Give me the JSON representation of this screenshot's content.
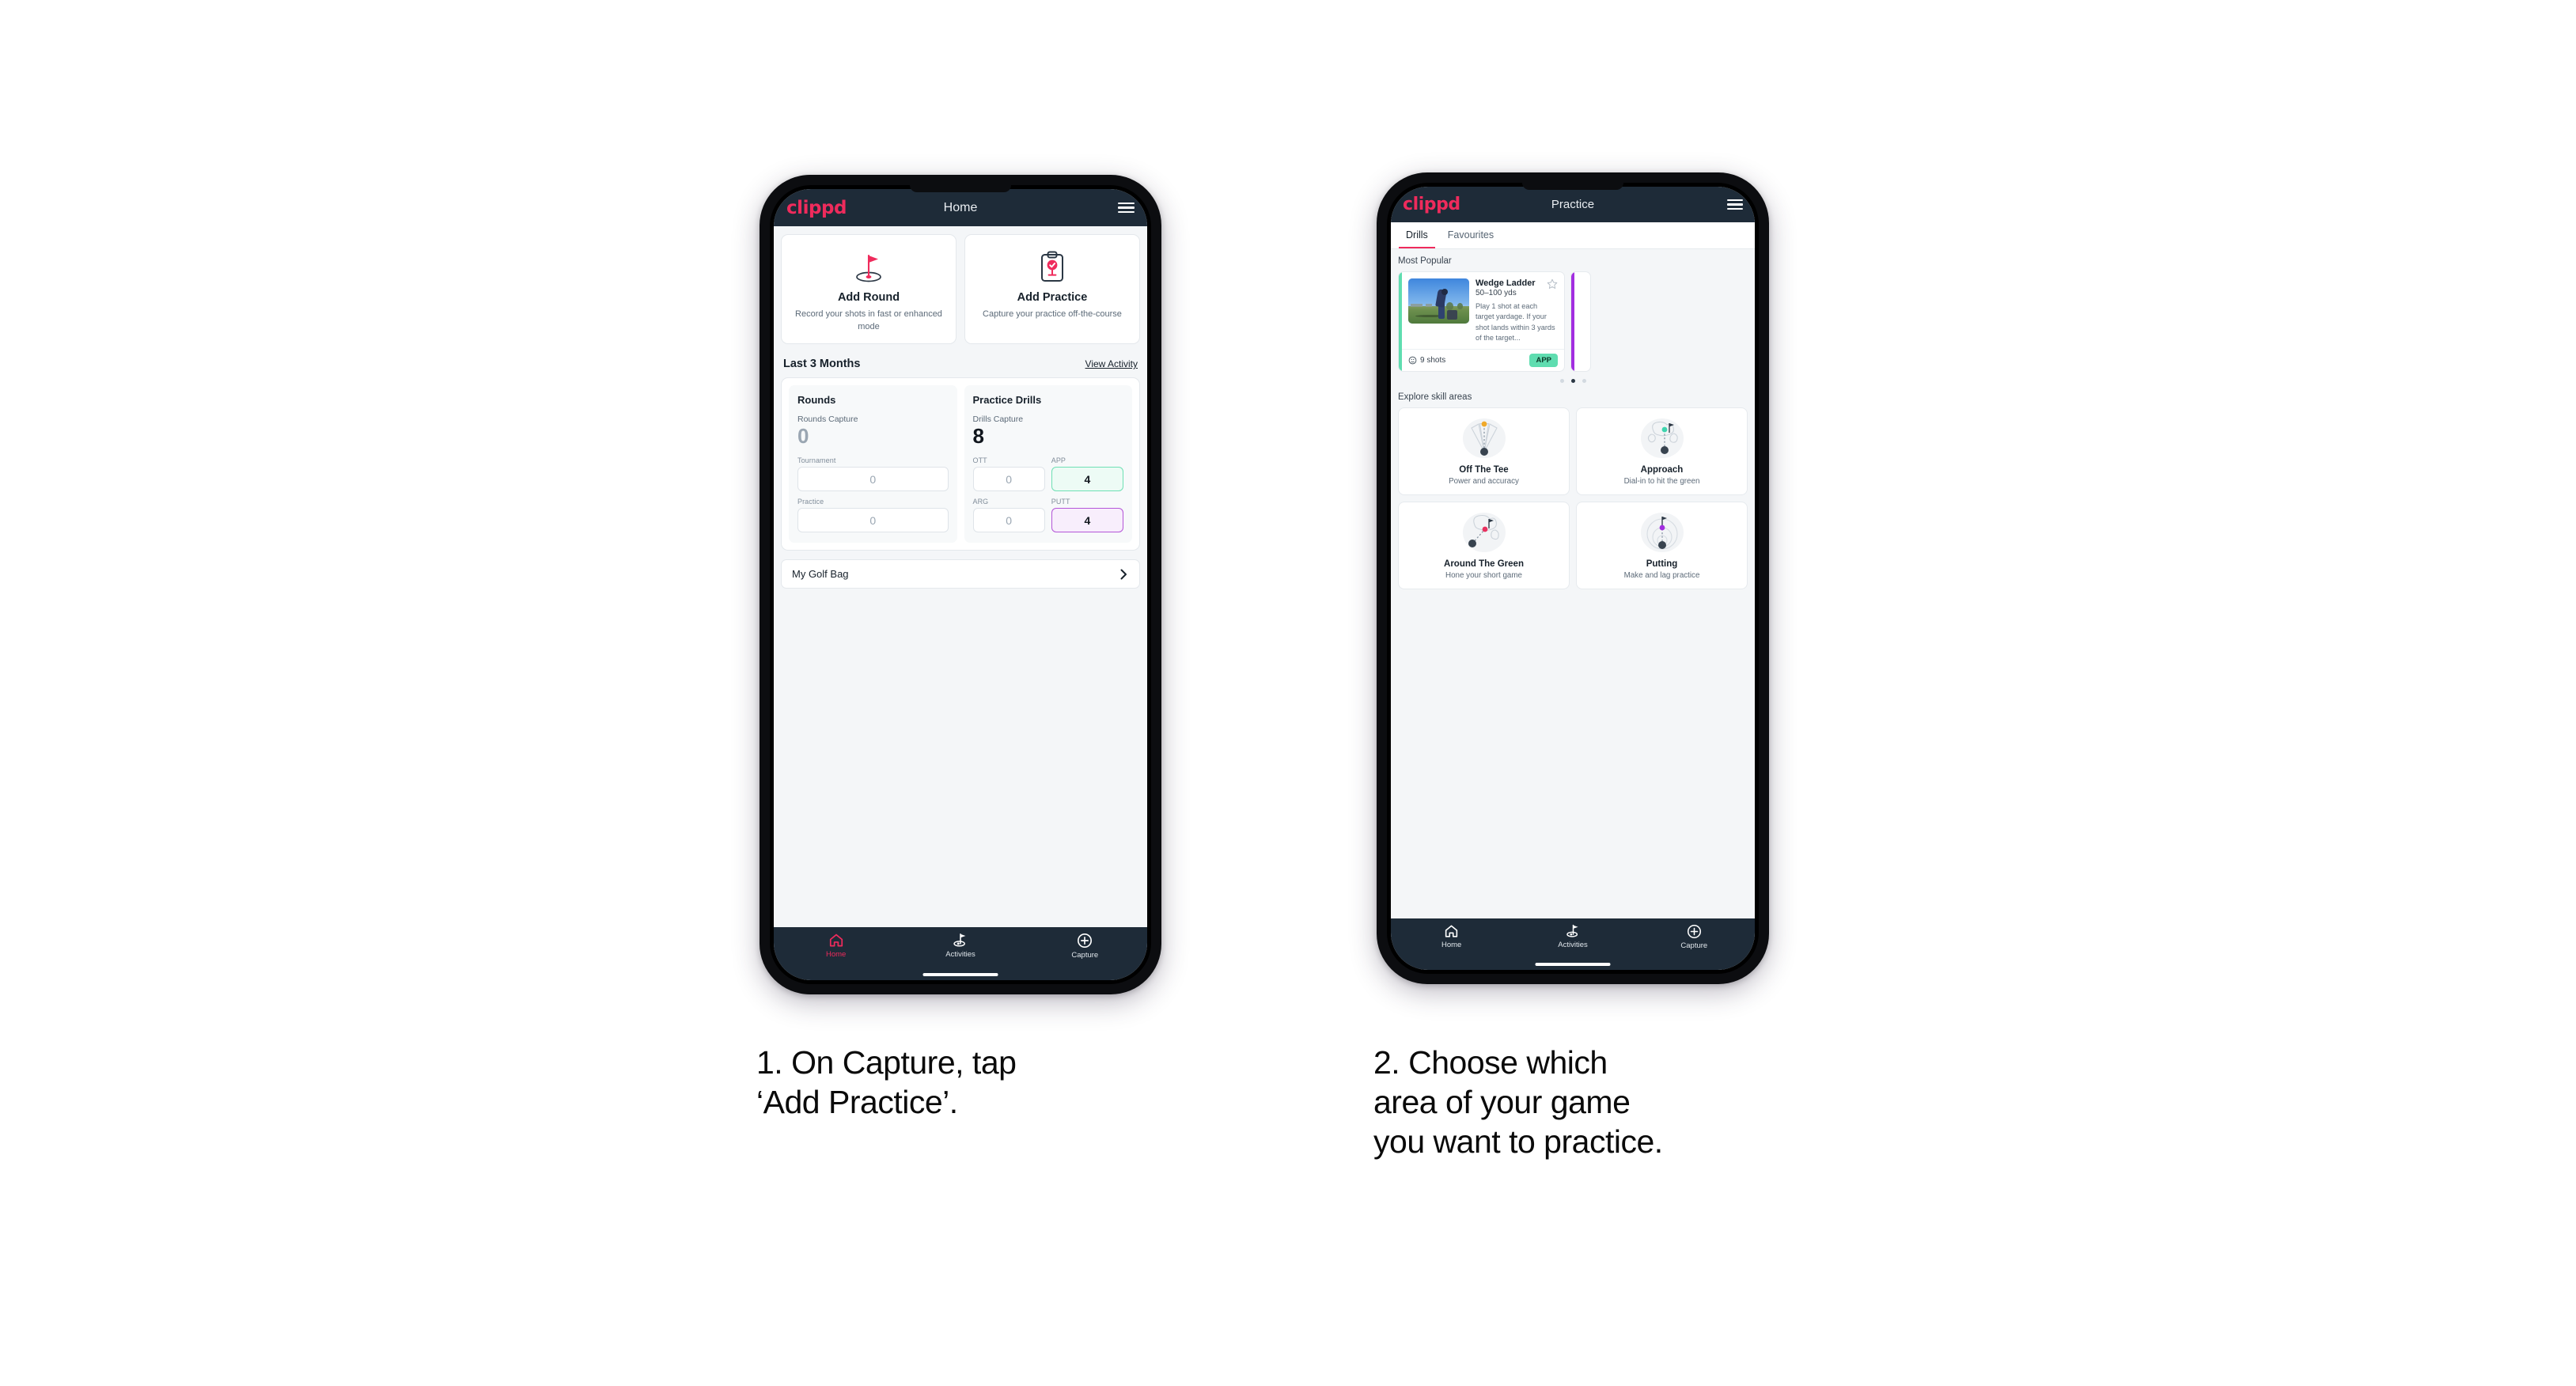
{
  "phone1": {
    "appbar": {
      "logo": "clippd",
      "title": "Home",
      "menu_icon": "hamburger-icon"
    },
    "actions": [
      {
        "icon": "golf-flag-hole-icon",
        "title": "Add Round",
        "subtitle": "Record your shots in fast or enhanced mode"
      },
      {
        "icon": "clipboard-check-icon",
        "title": "Add Practice",
        "subtitle": "Capture your practice off-the-course"
      }
    ],
    "section": {
      "title": "Last 3 Months",
      "link": "View Activity"
    },
    "rounds": {
      "heading": "Rounds",
      "capture_label": "Rounds Capture",
      "capture_value": "0",
      "fields": [
        {
          "label": "Tournament",
          "value": "0",
          "state": "empty"
        },
        {
          "label": "Practice",
          "value": "0",
          "state": "empty"
        }
      ]
    },
    "drills": {
      "heading": "Practice Drills",
      "capture_label": "Drills Capture",
      "capture_value": "8",
      "fields": [
        {
          "label": "OTT",
          "value": "0",
          "state": "empty"
        },
        {
          "label": "APP",
          "value": "4",
          "state": "app"
        },
        {
          "label": "ARG",
          "value": "0",
          "state": "empty"
        },
        {
          "label": "PUTT",
          "value": "4",
          "state": "putt"
        }
      ]
    },
    "golf_bag": {
      "label": "My Golf Bag",
      "chevron": "chevron-right-icon"
    },
    "bottom_nav": [
      {
        "icon": "home-icon",
        "label": "Home",
        "active": true
      },
      {
        "icon": "golf-flag-icon",
        "label": "Activities",
        "active": false
      },
      {
        "icon": "plus-circle-icon",
        "label": "Capture",
        "active": false
      }
    ]
  },
  "phone2": {
    "appbar": {
      "logo": "clippd",
      "title": "Practice",
      "menu_icon": "hamburger-icon"
    },
    "tabs": [
      {
        "label": "Drills",
        "active": true
      },
      {
        "label": "Favourites",
        "active": false
      }
    ],
    "most_popular_heading": "Most Popular",
    "drill": {
      "title": "Wedge Ladder",
      "yardage": "50–100 yds",
      "description": "Play 1 shot at each target yardage. If your shot lands within 3 yards of the target...",
      "shots": "9 shots",
      "shots_icon": "clock-icon",
      "badge": "APP",
      "star_icon": "star-outline-icon",
      "accent_color": "#5fddb0"
    },
    "next_card_accent": "#a22ee0",
    "pager": {
      "count": 3,
      "active_index": 1
    },
    "skill_heading": "Explore skill areas",
    "skill_areas": [
      {
        "icon": "tee-dispersion-icon",
        "title": "Off The Tee",
        "subtitle": "Power and accuracy",
        "dot_color": "#f0a92a"
      },
      {
        "icon": "green-approach-icon",
        "title": "Approach",
        "subtitle": "Dial-in to hit the green",
        "dot_color": "#3fd4ae"
      },
      {
        "icon": "chip-green-icon",
        "title": "Around The Green",
        "subtitle": "Hone your short game",
        "dot_color": "#e8315f"
      },
      {
        "icon": "putting-rings-icon",
        "title": "Putting",
        "subtitle": "Make and lag practice",
        "dot_color": "#a22ee0"
      }
    ],
    "bottom_nav": [
      {
        "icon": "home-icon",
        "label": "Home",
        "active": false
      },
      {
        "icon": "golf-flag-icon",
        "label": "Activities",
        "active": false
      },
      {
        "icon": "plus-circle-icon",
        "label": "Capture",
        "active": false
      }
    ]
  },
  "captions": {
    "step1_line1": "1. On Capture, tap",
    "step1_line2": "‘Add Practice’.",
    "step2_line1": "2. Choose which",
    "step2_line2": "area of your game",
    "step2_line3": "you want to practice."
  },
  "colors": {
    "brand_pink": "#ef2b5c",
    "navy": "#1e2b38",
    "mint": "#5fddb0",
    "purple": "#a22ee0"
  }
}
